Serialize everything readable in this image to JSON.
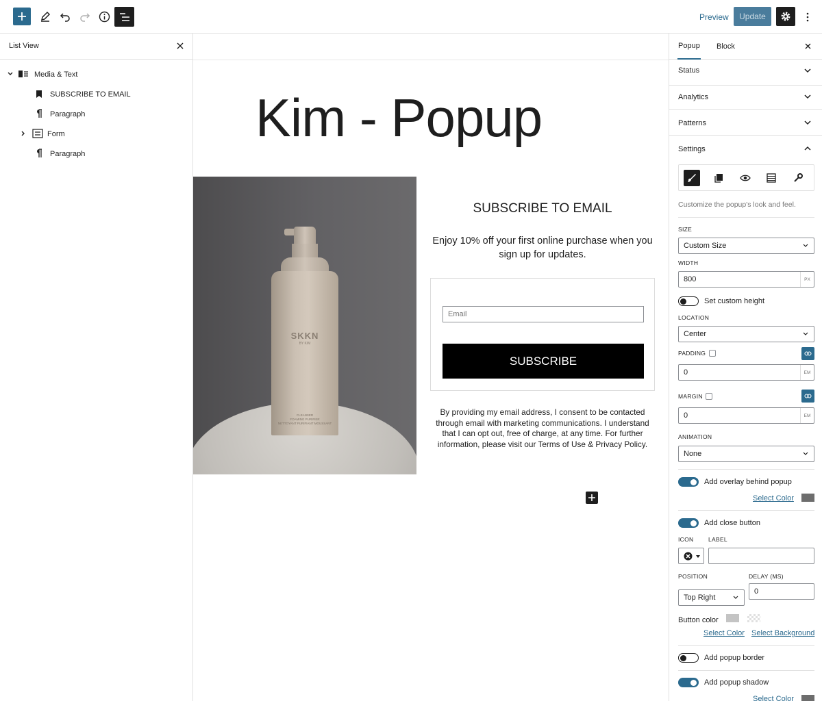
{
  "toolbar": {
    "add_icon": "plus-icon",
    "tools_icon": "pencil-icon",
    "undo_icon": "undo-icon",
    "redo_icon": "redo-icon",
    "details_icon": "info-icon",
    "list_view_icon": "list-view-icon",
    "preview_label": "Preview",
    "update_label": "Update",
    "settings_icon": "gear-icon",
    "more_icon": "kebab-icon"
  },
  "list_view": {
    "title": "List View",
    "items": [
      {
        "label": "Media & Text",
        "icon": "media-text-icon"
      },
      {
        "label": "SUBSCRIBE TO EMAIL",
        "icon": "bookmark-icon"
      },
      {
        "label": "Paragraph",
        "icon": "pilcrow-icon"
      },
      {
        "label": "Form",
        "icon": "form-icon"
      },
      {
        "label": "Paragraph",
        "icon": "pilcrow-icon"
      }
    ]
  },
  "canvas": {
    "title": "Kim - Popup",
    "image": {
      "brand": "SKKN",
      "brand_sub": "BY KIM",
      "fine_print": "CLEANSER\nFOAMING PURIFIER\nNETTOYANT PURIFIANT MOUSSANT"
    },
    "heading": "SUBSCRIBE TO EMAIL",
    "description": "Enjoy 10% off your first online purchase when you sign up for updates.",
    "email_placeholder": "Email",
    "subscribe_label": "SUBSCRIBE",
    "consent": "By providing my email address, I consent to be contacted through email with marketing communications. I understand that I can opt out, free of charge, at any time. For further information, please visit our Terms of Use & Privacy Policy."
  },
  "sidebar": {
    "tabs": [
      "Popup",
      "Block"
    ],
    "active_tab": "Popup",
    "sections": [
      "Status",
      "Analytics",
      "Patterns",
      "Settings"
    ],
    "settings_icons": [
      "brush-icon",
      "page-icon",
      "eye-icon",
      "table-icon",
      "wrench-icon"
    ],
    "settings_desc": "Customize the popup's look and feel.",
    "size_label": "SIZE",
    "size_value": "Custom Size",
    "width_label": "WIDTH",
    "width_value": "800",
    "width_unit": "PX",
    "custom_height_label": "Set custom height",
    "custom_height_on": false,
    "location_label": "LOCATION",
    "location_value": "Center",
    "padding_label": "PADDING",
    "padding_value": "0",
    "padding_unit": "EM",
    "margin_label": "MARGIN",
    "margin_value": "0",
    "margin_unit": "EM",
    "animation_label": "ANIMATION",
    "animation_value": "None",
    "overlay_label": "Add overlay behind popup",
    "overlay_on": true,
    "select_color_label": "Select Color",
    "close_button_label": "Add close button",
    "close_button_on": true,
    "icon_label": "ICON",
    "label_label": "LABEL",
    "label_value": "",
    "position_label": "POSITION",
    "position_value": "Top Right",
    "delay_label": "DELAY (MS)",
    "delay_value": "0",
    "button_color_label": "Button color",
    "select_color_label_2": "Select Color",
    "select_background_label": "Select Background",
    "border_label": "Add popup border",
    "border_on": false,
    "shadow_label": "Add popup shadow",
    "shadow_on": true,
    "select_color_label_3": "Select Color"
  },
  "colors": {
    "accent": "#2b6a8e",
    "update_bg": "#4a7c9c",
    "dark": "#1e1e1e",
    "overlay_swatch": "#6d6d6d",
    "button_swatch": "#c4c4c4"
  }
}
